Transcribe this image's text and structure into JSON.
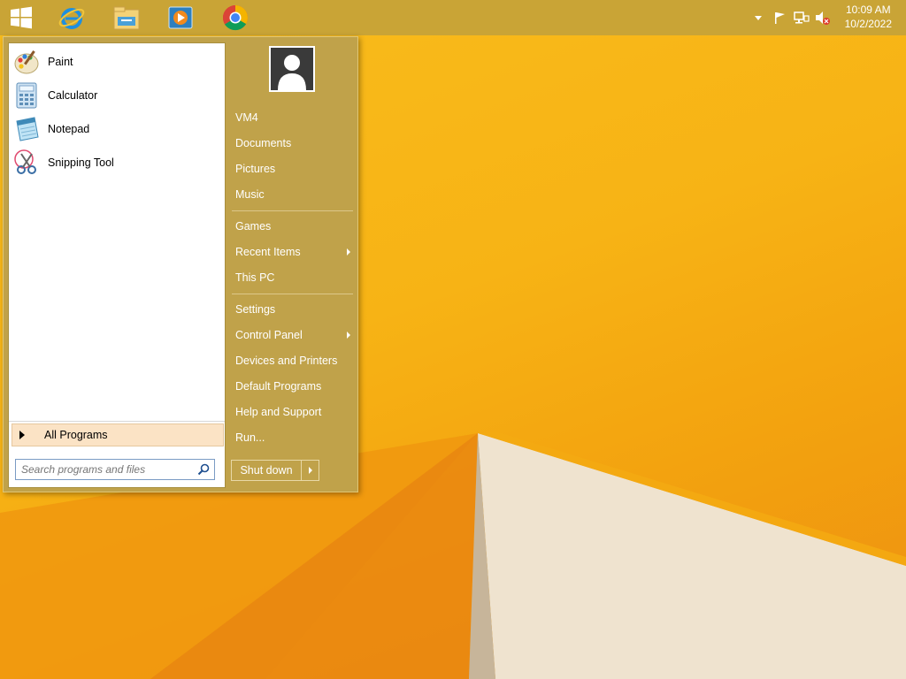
{
  "taskbar": {
    "pinned": [
      {
        "name": "start-button",
        "icon": "windows-logo-icon"
      },
      {
        "name": "internet-explorer",
        "icon": "internet-explorer-icon"
      },
      {
        "name": "file-explorer",
        "icon": "file-explorer-icon"
      },
      {
        "name": "media-player",
        "icon": "media-player-icon"
      },
      {
        "name": "chrome",
        "icon": "chrome-icon"
      }
    ],
    "tray_icons": [
      "show-hidden-icons-chevron-icon",
      "action-center-flag-icon",
      "network-icon",
      "volume-muted-icon"
    ],
    "clock": {
      "time": "10:09 AM",
      "date": "10/2/2022"
    }
  },
  "start_menu": {
    "programs": [
      {
        "label": "Paint",
        "icon": "paint-icon"
      },
      {
        "label": "Calculator",
        "icon": "calculator-icon"
      },
      {
        "label": "Notepad",
        "icon": "notepad-icon"
      },
      {
        "label": "Snipping Tool",
        "icon": "snipping-tool-icon"
      }
    ],
    "all_programs": "All Programs",
    "search_placeholder": "Search programs and files",
    "user_avatar": "user-avatar-icon",
    "right_items": {
      "vm4": "VM4",
      "documents": "Documents",
      "pictures": "Pictures",
      "music": "Music",
      "games": "Games",
      "recent_items": "Recent Items",
      "this_pc": "This PC",
      "settings": "Settings",
      "control_panel": "Control Panel",
      "devices_printers": "Devices and Printers",
      "default_programs": "Default Programs",
      "help_support": "Help and Support",
      "run": "Run..."
    },
    "shutdown": "Shut down"
  },
  "colors": {
    "taskbar": "#c9a436",
    "start_menu_bg": "#c0a24a",
    "desktop_yellow": "#f9bd1c",
    "desktop_orange": "#ee8f10"
  }
}
